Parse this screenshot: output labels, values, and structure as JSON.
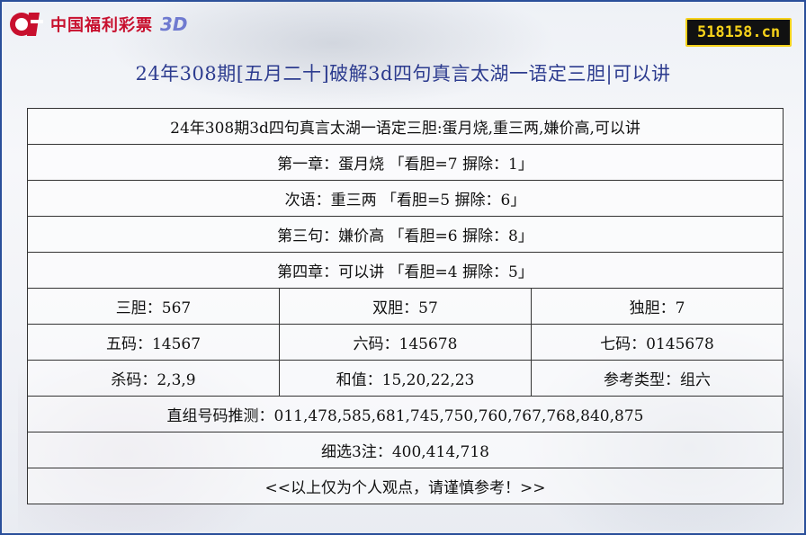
{
  "header": {
    "logo_text": "中国福利彩票",
    "logo_3d": "3D",
    "site_badge": "518158.cn",
    "title": "24年308期[五月二十]破解3d四句真言太湖一语定三胆|可以讲"
  },
  "table": {
    "summary": "24年308期3d四句真言太湖一语定三胆:蛋月烧,重三两,嫌价高,可以讲",
    "lines": [
      "第一章：蛋月烧 「看胆=7 摒除：1」",
      "次语：重三两 「看胆=5 摒除：6」",
      "第三句：嫌价高 「看胆=6 摒除：8」",
      "第四章：可以讲 「看胆=4 摒除：5」"
    ],
    "grid": [
      [
        "三胆：567",
        "双胆：57",
        "独胆：7"
      ],
      [
        "五码：14567",
        "六码：145678",
        "七码：0145678"
      ],
      [
        "杀码：2,3,9",
        "和值：15,20,22,23",
        "参考类型：组六"
      ]
    ],
    "direct_prediction": "直组号码推测：011,478,585,681,745,750,760,767,768,840,875",
    "group3": "细选3注：400,414,718",
    "disclaimer": "<<以上仅为个人观点，请谨慎参考！>>"
  },
  "colors": {
    "frame": "#2a4f9a",
    "title": "#2d3c8f",
    "logo_red": "#c8102e",
    "badge_bg": "#111111",
    "badge_text": "#f6d21a"
  }
}
